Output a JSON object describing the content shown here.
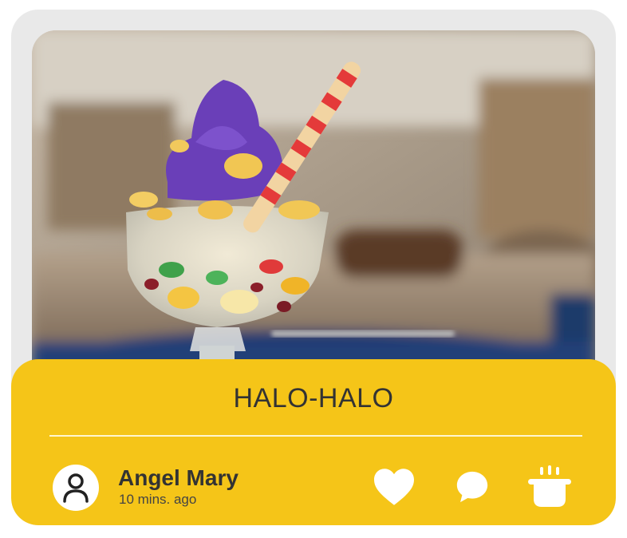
{
  "post": {
    "title": "HALO-HALO",
    "photo_subject": "halo-halo dessert in a glass cup",
    "author": {
      "name": "Angel Mary",
      "time": "10 mins. ago",
      "avatar_icon": "user-icon"
    }
  },
  "actions": [
    {
      "icon": "heart-icon"
    },
    {
      "icon": "chat-bubble-icon"
    },
    {
      "icon": "cooking-pot-icon"
    }
  ],
  "colors": {
    "card_background": "#e9e9e9",
    "panel": "#f5c518",
    "text_dark": "#333333",
    "icon": "#ffffff"
  }
}
